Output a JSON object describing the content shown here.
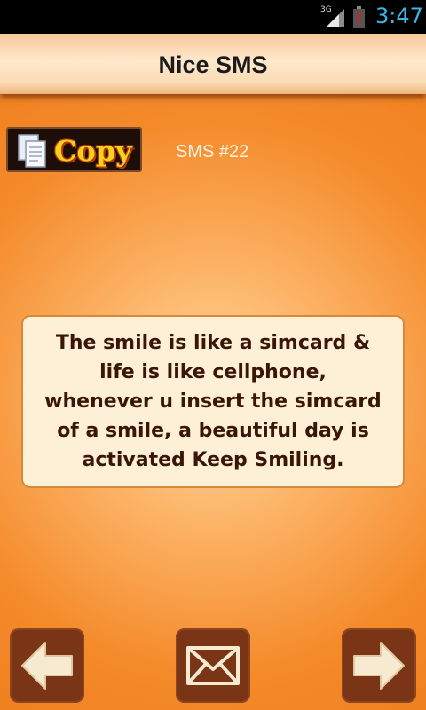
{
  "status_bar": {
    "network": "3G",
    "time": "3:47",
    "icons": [
      "signal-icon",
      "battery-alert-icon"
    ]
  },
  "header": {
    "title": "Nice SMS"
  },
  "toolbar": {
    "copy_label": "Copy",
    "copy_icon": "copy-document-icon",
    "sms_number": "SMS #22"
  },
  "message": {
    "text": "The smile is like a simcard & life is like cellphone, whenever u insert the simcard of a smile, a beautiful day is activated Keep Smiling."
  },
  "navigation": {
    "prev_icon": "arrow-left-icon",
    "send_icon": "envelope-icon",
    "next_icon": "arrow-right-icon"
  },
  "colors": {
    "background": "#f48a2a",
    "card": "#fdf0d6",
    "button": "#7a3416",
    "accent": "#f7d21b",
    "clock": "#3db5e6"
  }
}
